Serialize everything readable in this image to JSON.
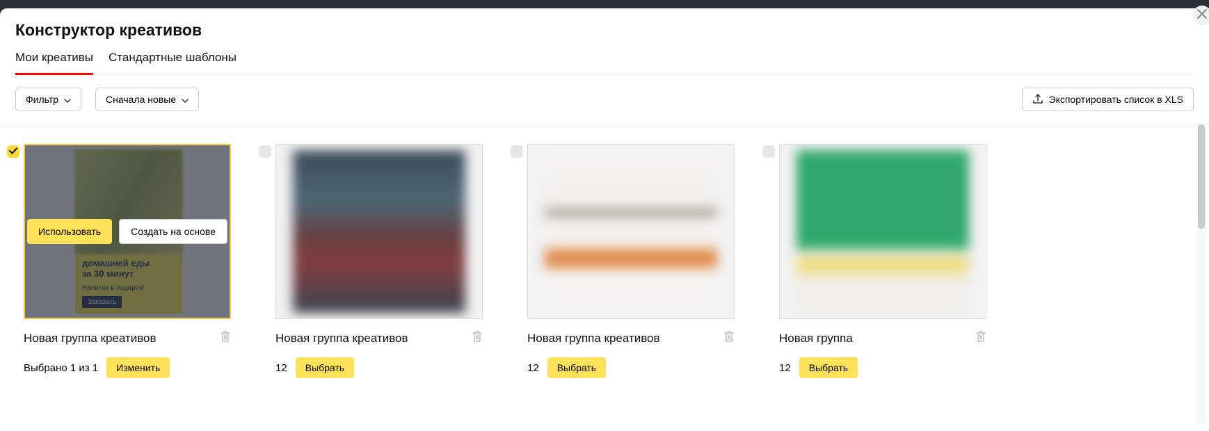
{
  "modal": {
    "title": "Конструктор креативов",
    "tabs": [
      {
        "label": "Мои креативы",
        "active": true
      },
      {
        "label": "Стандартные шаблоны",
        "active": false
      }
    ]
  },
  "toolbar": {
    "filter_label": "Фильтр",
    "sort_label": "Сначала новые",
    "export_label": "Экспортировать список в XLS"
  },
  "overlay_actions": {
    "use": "Использовать",
    "create_from": "Создать на основе"
  },
  "ad_mock": {
    "line1": "домашней еды",
    "line2": "за 30 минут",
    "sub": "Напиток в подарок!",
    "order": "Заказать"
  },
  "cards": [
    {
      "title": "Новая группа креативов",
      "checked": true,
      "selected": true,
      "sub_text": "Выбрано 1 из 1",
      "action_label": "Изменить",
      "thumb_style": "ad"
    },
    {
      "title": "Новая группа креативов",
      "checked": false,
      "selected": false,
      "sub_text": "12",
      "action_label": "Выбрать",
      "thumb_style": "bt1"
    },
    {
      "title": "Новая группа креативов",
      "checked": false,
      "selected": false,
      "sub_text": "12",
      "action_label": "Выбрать",
      "thumb_style": "bt2"
    },
    {
      "title": "Новая группа",
      "checked": false,
      "selected": false,
      "sub_text": "12",
      "action_label": "Выбрать",
      "thumb_style": "bt3"
    }
  ]
}
